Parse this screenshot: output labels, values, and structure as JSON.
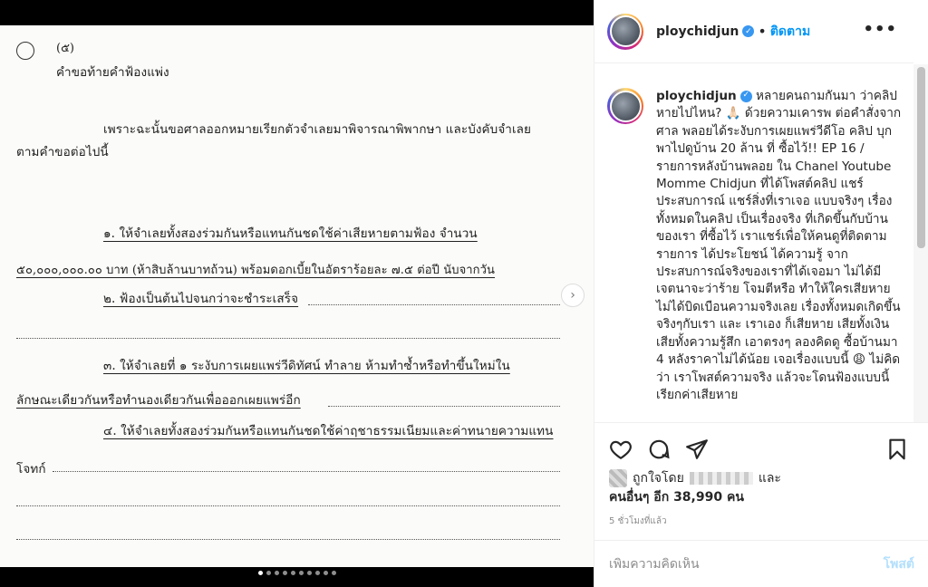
{
  "post": {
    "username": "ploychidjun",
    "follow_label": "ติดตาม",
    "separator": "•",
    "more_label": "•••",
    "verified_label": "✓"
  },
  "document": {
    "page_number": "(๕)",
    "heading": "คำขอท้ายคำฟ้องแพ่ง",
    "lines": [
      "เพราะฉะนั้นขอศาลออกหมายเรียกตัวจำเลยมาพิจารณาพิพากษา และบังคับจำเลย",
      "ตามคำขอต่อไปนี้",
      "๑. ให้จำเลยทั้งสองร่วมกันหรือแทนกันชดใช้ค่าเสียหายตามฟ้อง จำนวน",
      "๕๐,๐๐๐,๐๐๐.๐๐ บาท (ห้าสิบล้านบาทถ้วน) พร้อมดอกเบี้ยในอัตราร้อยละ ๗.๕ ต่อปี นับจากวัน",
      "๒. ฟ้องเป็นต้นไปจนกว่าจะชำระเสร็จ",
      "๓. ให้จำเลยที่ ๑ ระงับการเผยแพร่วีดิทัศน์ ทำลาย ห้ามทำซ้ำหรือทำขึ้นใหม่ใน",
      "ลักษณะเดียวกันหรือทำนองเดียวกันเพื่อออกเผยแพร่อีก",
      "๔. ให้จำเลยทั้งสองร่วมกันหรือแทนกันชดใช้ค่าฤชาธรรมเนียมและค่าทนายความแทน",
      "โจทก์"
    ]
  },
  "caption": {
    "text": " หลายคนถามกันมา ว่าคลิปหายไปไหน? 🙏🏻 ด้วยความเคารพ ต่อคำสั่งจากศาล พลอยได้ระงับการเผยแพร่วีดีโอ คลิป บุกพาไปดูบ้าน 20 ล้าน ที่ ซื้อไว้!! EP 16 / รายการหลังบ้านพลอย ใน Chanel Youtube Momme Chidjun ที่ได้โพสต์คลิป แชร์ประสบการณ์ แชร์สิ่งที่เราเจอ แบบจริงๆ เรื่องทั้งหมดในคลิป เป็นเรื่องจริง ที่เกิดขึ้นกับบ้านของเรา ที่ซื้อไว้ เราแชร์เพื่อให้คนดูที่ติดตามรายการ ได้ประโยชน์ ได้ความรู้ จากประสบการณ์จริงของเราที่ได้เจอมา ไม่ได้มีเจตนาจะว่าร้าย โจมตีหรือ ทำให้ใครเสียหาย ไม่ได้บิดเบือนความจริงเลย เรื่องทั้งหมดเกิดขึ้นจริงๆกับเรา และ เราเอง ก็เสียหาย เสียทั้งเงิน เสียทั้งความรู้สึก เอาตรงๆ ลองคิดดู ซื้อบ้านมา 4 หลังราคาไม่ได้น้อย เจอเรื่องแบบนี้ 😩 ไม่คิดว่า เราโพสต์ความจริง แล้วจะโดนฟ้องแบบนี้ เรียกค่าเสียหาย"
  },
  "likes": {
    "liked_by_prefix": "ถูกใจโดย",
    "and_label": "และ",
    "others_label": "คนอื่นๆ อีก 38,990 คน"
  },
  "timestamp": "5 ชั่วโมงที่แล้ว",
  "comment": {
    "placeholder": "เพิ่มความคิดเห็น",
    "post_label": "โพสต์"
  },
  "carousel": {
    "total": 10,
    "active_index": 0
  },
  "colors": {
    "accent": "#0095f6",
    "verified": "#3897f0",
    "post_disabled": "#b2dffc"
  }
}
